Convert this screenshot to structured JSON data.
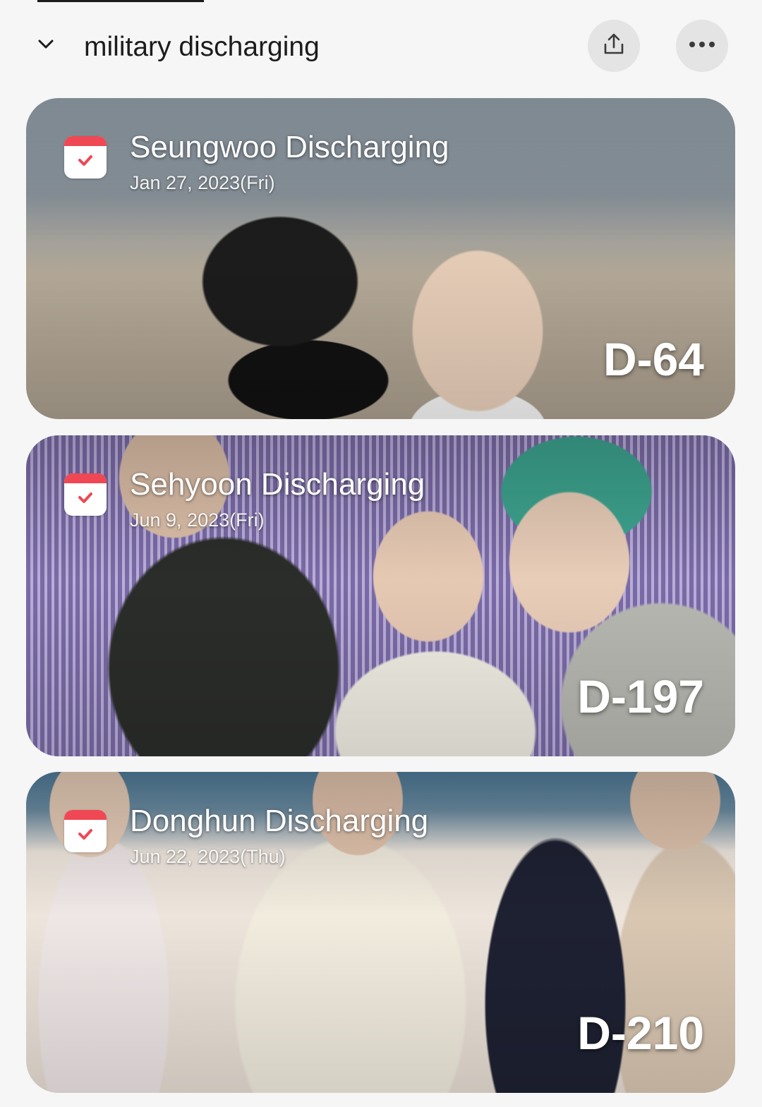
{
  "header": {
    "group_title": "military discharging",
    "collapse_icon": "chevron-down-icon",
    "share_icon": "share-icon",
    "more_icon": "more-horizontal-icon"
  },
  "events": [
    {
      "title": "Seungwoo Discharging",
      "date": "Jan 27, 2023(Fri)",
      "dday": "D-64",
      "icon": "calendar-check-icon",
      "photo_palette": [
        "#7d8a94",
        "#b9b1a3",
        "#2a2a2a",
        "#e7ddd5"
      ]
    },
    {
      "title": "Sehyoon Discharging",
      "date": "Jun 9, 2023(Fri)",
      "dday": "D-197",
      "icon": "calendar-check-icon",
      "photo_palette": [
        "#6d5a93",
        "#3a3a3a",
        "#3fa08e",
        "#c9c0b4"
      ]
    },
    {
      "title": "Donghun Discharging",
      "date": "Jun 22, 2023(Thu)",
      "dday": "D-210",
      "icon": "calendar-check-icon",
      "photo_palette": [
        "#4d7b99",
        "#eadfd4",
        "#1f2233",
        "#c8b6a0"
      ]
    }
  ],
  "colors": {
    "background": "#f6f6f6",
    "button_bg": "#e4e4e4",
    "calendar_red": "#ef4854",
    "text_dark": "#1c1c1c"
  }
}
